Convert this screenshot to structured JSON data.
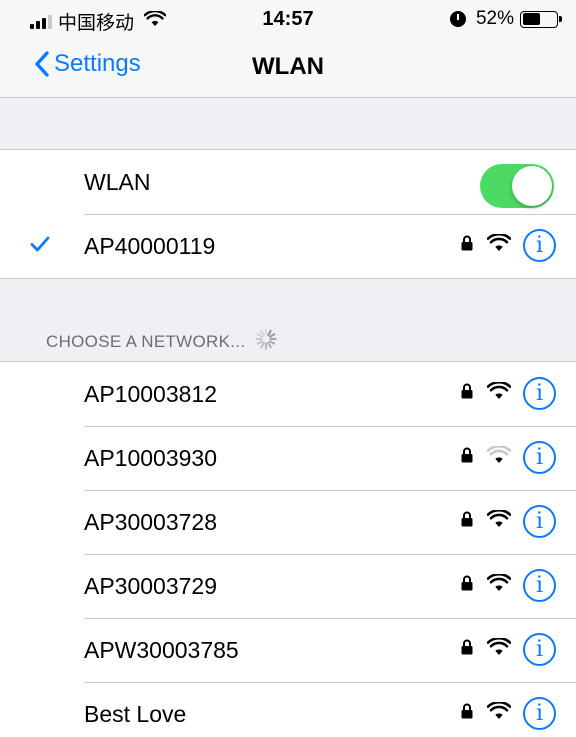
{
  "status_bar": {
    "carrier": "中国移动",
    "time": "14:57",
    "battery": "52%",
    "battery_level": 0.52
  },
  "nav": {
    "back_label": "Settings",
    "title": "WLAN"
  },
  "wlan": {
    "label": "WLAN",
    "enabled": true,
    "toggle_color": "#4cd964"
  },
  "connected": {
    "name": "AP40000119",
    "secured": true,
    "signal": "full"
  },
  "section": {
    "header": "CHOOSE A NETWORK..."
  },
  "networks": [
    {
      "name": "AP10003812",
      "secured": true,
      "signal": "full"
    },
    {
      "name": "AP10003930",
      "secured": true,
      "signal": "weak"
    },
    {
      "name": "AP30003728",
      "secured": true,
      "signal": "full"
    },
    {
      "name": "AP30003729",
      "secured": true,
      "signal": "full"
    },
    {
      "name": "APW30003785",
      "secured": true,
      "signal": "full"
    },
    {
      "name": "Best Love",
      "secured": true,
      "signal": "full"
    }
  ],
  "colors": {
    "accent": "#0a7aff",
    "background": "#efeff4",
    "separator": "#c8c7cc"
  },
  "icons": {
    "lock": "lock-icon",
    "wifi": "wifi-icon",
    "info": "info-icon",
    "check": "checkmark-icon"
  },
  "info_glyph": "i"
}
